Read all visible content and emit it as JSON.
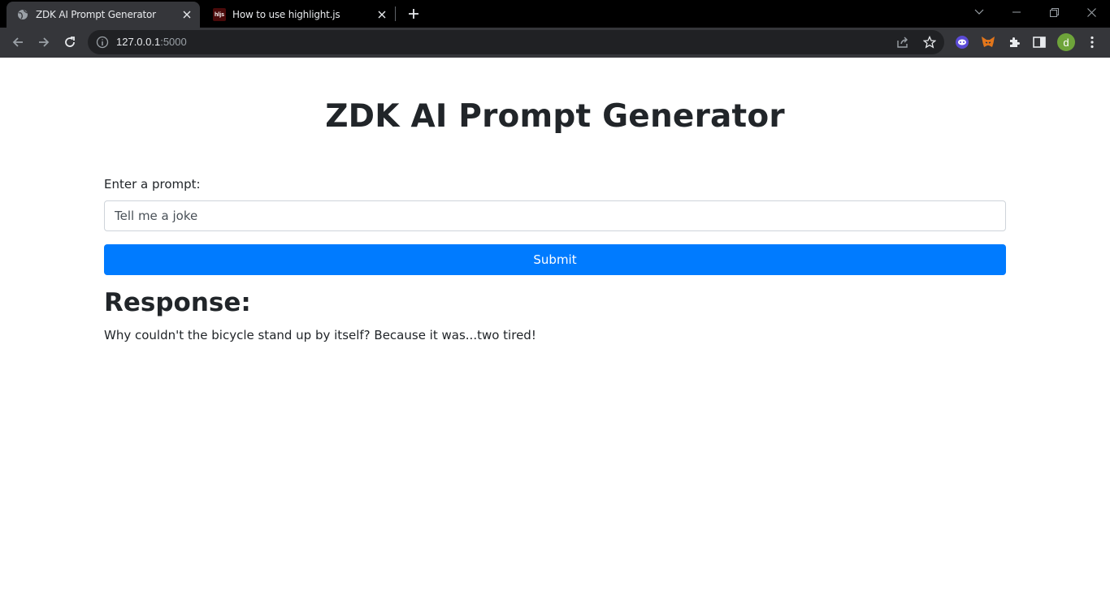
{
  "browser": {
    "tabs": [
      {
        "title": "ZDK AI Prompt Generator",
        "active": true,
        "favicon": "globe-icon"
      },
      {
        "title": "How to use highlight.js",
        "active": false,
        "favicon": "hljs-icon",
        "favicon_text": "hljs"
      }
    ],
    "address": {
      "host": "127.0.0.1",
      "port": ":5000"
    },
    "profile_initial": "d",
    "colors": {
      "tabstrip": "#000000",
      "toolbar": "#35363a",
      "omnibox": "#202124",
      "avatar": "#6ea43a"
    }
  },
  "page": {
    "title": "ZDK AI Prompt Generator",
    "prompt_label": "Enter a prompt:",
    "prompt_value": "Tell me a joke",
    "submit_label": "Submit",
    "response_heading": "Response:",
    "response_text": "Why couldn't the bicycle stand up by itself? Because it was...two tired!",
    "colors": {
      "primary": "#007bff",
      "text": "#212529"
    }
  }
}
